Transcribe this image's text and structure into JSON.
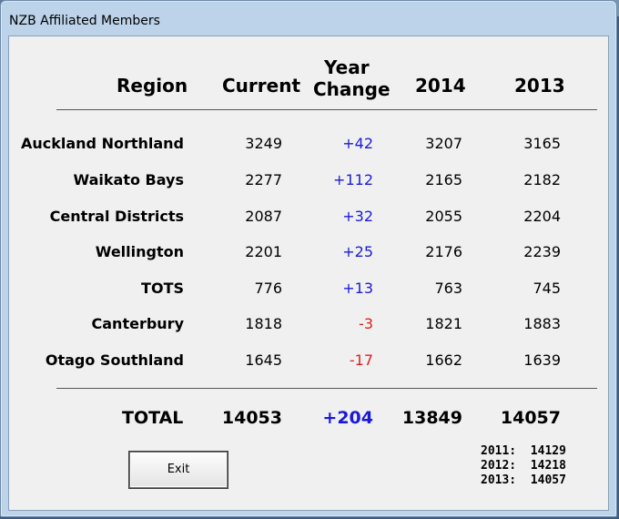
{
  "window": {
    "title": "NZB Affiliated Members"
  },
  "headers": {
    "region": "Region",
    "current": "Current",
    "change_line1": "Year",
    "change_line2": "Change",
    "y2014": "2014",
    "y2013": "2013"
  },
  "rows": [
    {
      "region": "Auckland Northland",
      "current": "3249",
      "change": "+42",
      "y2014": "3207",
      "y2013": "3165"
    },
    {
      "region": "Waikato Bays",
      "current": "2277",
      "change": "+112",
      "y2014": "2165",
      "y2013": "2182"
    },
    {
      "region": "Central Districts",
      "current": "2087",
      "change": "+32",
      "y2014": "2055",
      "y2013": "2204"
    },
    {
      "region": "Wellington",
      "current": "2201",
      "change": "+25",
      "y2014": "2176",
      "y2013": "2239"
    },
    {
      "region": "TOTS",
      "current": "776",
      "change": "+13",
      "y2014": "763",
      "y2013": "745"
    },
    {
      "region": "Canterbury",
      "current": "1818",
      "change": "-3",
      "y2014": "1821",
      "y2013": "1883"
    },
    {
      "region": "Otago Southland",
      "current": "1645",
      "change": "-17",
      "y2014": "1662",
      "y2013": "1639"
    }
  ],
  "total": {
    "label": "TOTAL",
    "current": "14053",
    "change": "+204",
    "y2014": "13849",
    "y2013": "14057"
  },
  "exit_button": {
    "label": "Exit"
  },
  "history": [
    {
      "year": "2011:",
      "value": "14129"
    },
    {
      "year": "2012:",
      "value": "14218"
    },
    {
      "year": "2013:",
      "value": "14057"
    }
  ],
  "colors": {
    "positive": "#1a1ad6",
    "negative": "#e02020"
  }
}
